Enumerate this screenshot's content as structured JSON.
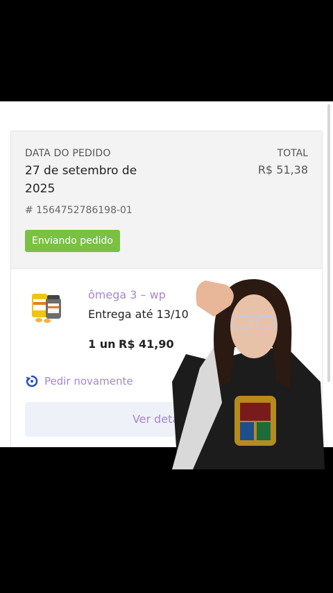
{
  "order": {
    "date_label": "DATA DO PEDIDO",
    "date_value": "27 de setembro de 2025",
    "total_label": "TOTAL",
    "total_value": "R$ 51,38",
    "number": "# 1564752786198-01",
    "status": "Enviando pedido"
  },
  "item": {
    "name": "ômega 3 – wp",
    "delivery": "Entrega até 13/10",
    "quantity": "1 un",
    "price": "R$ 41,90"
  },
  "actions": {
    "reorder_label": "Pedir novamente",
    "details_label": "Ver detalhes"
  },
  "colors": {
    "accent": "#a486d6",
    "status_bg": "#7ac142",
    "reorder_icon": "#2a52be"
  },
  "icons": {
    "reorder": "refresh-icon"
  }
}
